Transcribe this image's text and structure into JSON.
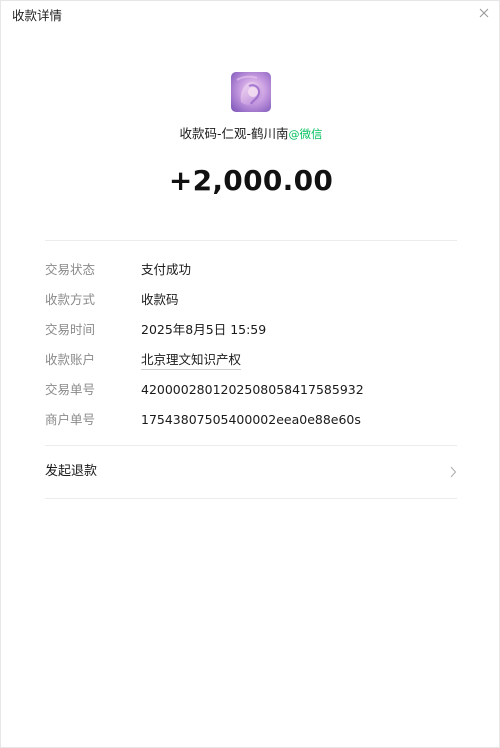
{
  "window": {
    "title": "收款详情"
  },
  "merchant": {
    "name": "收款码-仁观-鹤川南",
    "at_symbol": "@",
    "platform": "微信"
  },
  "amount": "+2,000.00",
  "details": [
    {
      "label": "交易状态",
      "value": "支付成功"
    },
    {
      "label": "收款方式",
      "value": "收款码"
    },
    {
      "label": "交易时间",
      "value": "2025年8月5日 15:59"
    },
    {
      "label": "收款账户",
      "value": "北京理文知识产权"
    },
    {
      "label": "交易单号",
      "value": "4200002801202508058417585932"
    },
    {
      "label": "商户单号",
      "value": "17543807505400002eea0e88e60s"
    }
  ],
  "actions": {
    "refund_label": "发起退款"
  },
  "icons": {
    "close": "close-icon",
    "avatar": "merchant-avatar",
    "chevron": "chevron-right-icon"
  },
  "colors": {
    "accent": "#07c160",
    "label": "#8a8a8a",
    "divider": "#ececec"
  }
}
